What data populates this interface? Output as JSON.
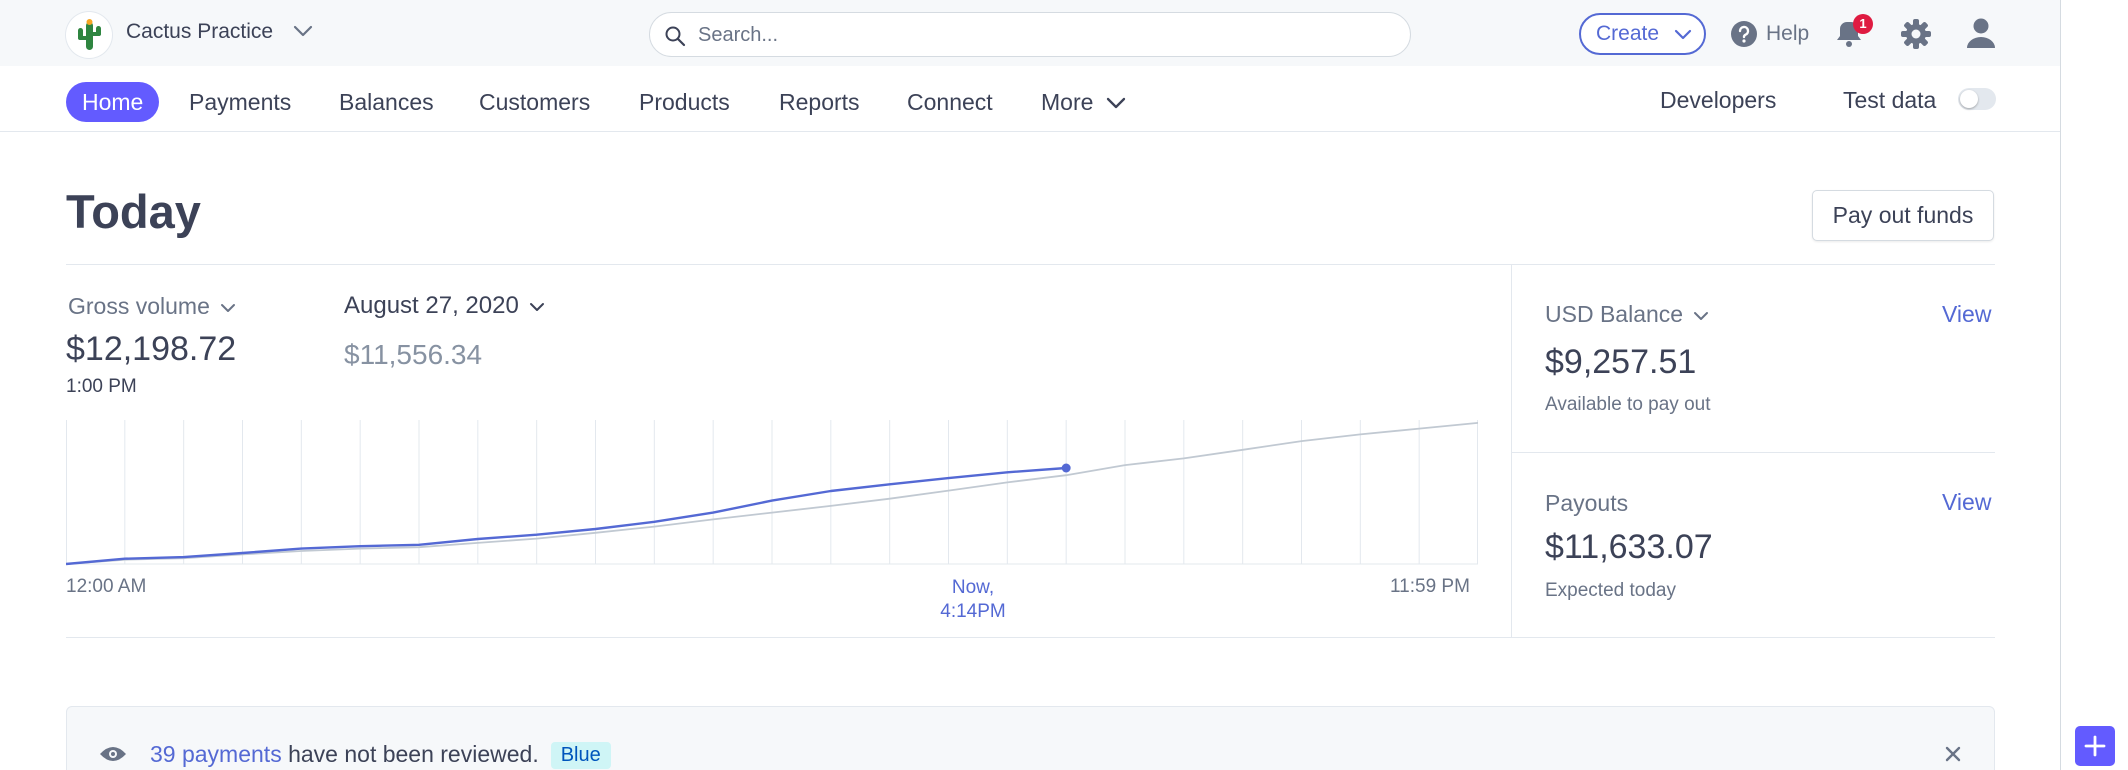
{
  "account": {
    "name": "Cactus Practice"
  },
  "search": {
    "placeholder": "Search..."
  },
  "header": {
    "create_label": "Create",
    "help_label": "Help",
    "notification_count": "1"
  },
  "nav": {
    "items": [
      "Home",
      "Payments",
      "Balances",
      "Customers",
      "Products",
      "Reports",
      "Connect",
      "More"
    ],
    "active": "Home",
    "developers_label": "Developers",
    "test_data_label": "Test data",
    "test_data_enabled": false
  },
  "page": {
    "title": "Today",
    "payout_button": "Pay out funds"
  },
  "gross": {
    "metric_label": "Gross volume",
    "value": "$12,198.72",
    "time": "1:00 PM",
    "compare_date": "August 27, 2020",
    "compare_value": "$11,556.34"
  },
  "axis": {
    "start": "12:00 AM",
    "now": "Now,",
    "now_time": "4:14PM",
    "end": "11:59 PM"
  },
  "balance": {
    "usd_title": "USD Balance",
    "usd_value": "$9,257.51",
    "usd_sub": "Available to pay out",
    "payouts_title": "Payouts",
    "payouts_value": "$11,633.07",
    "payouts_sub": "Expected today",
    "view_label": "View"
  },
  "review": {
    "link_text": "39 payments",
    "text": "have not been reviewed.",
    "badge": "Blue"
  },
  "colors": {
    "accent": "#635bff",
    "link": "#5469d4",
    "today_line": "#5469d4",
    "compare_line": "#c1c9d2"
  },
  "chart_data": {
    "type": "line",
    "x_hours": [
      0,
      1,
      2,
      3,
      4,
      5,
      6,
      7,
      8,
      9,
      10,
      11,
      12,
      13,
      14,
      15,
      16,
      17,
      18,
      19,
      20,
      21,
      22,
      23,
      24
    ],
    "series": [
      {
        "values": [
          0.0,
          0.55,
          0.72,
          1.15,
          1.6,
          1.85,
          2.0,
          2.6,
          3.05,
          3.65,
          4.4,
          5.35,
          6.6,
          7.6,
          8.3,
          8.95,
          9.55,
          10.0
        ]
      },
      {
        "values": [
          0.0,
          0.45,
          0.6,
          1.0,
          1.35,
          1.6,
          1.75,
          2.2,
          2.65,
          3.25,
          3.9,
          4.65,
          5.35,
          6.05,
          6.8,
          7.65,
          8.5,
          9.25,
          10.3,
          11.0,
          11.9,
          12.8,
          13.5,
          14.1,
          14.7
        ]
      }
    ],
    "x_range": [
      0,
      24
    ],
    "y_range": [
      0,
      15
    ],
    "grid": true
  }
}
